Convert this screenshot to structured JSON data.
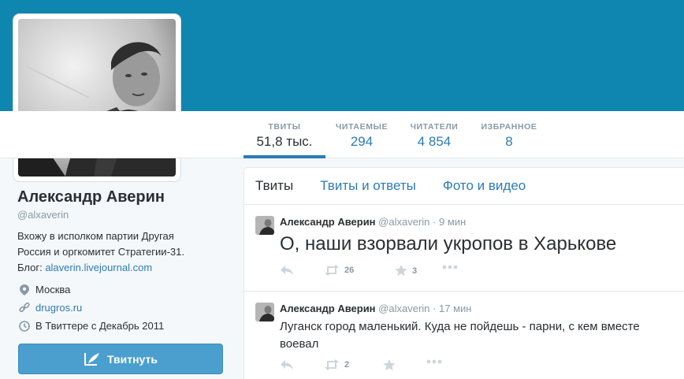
{
  "profile": {
    "name": "Александр Аверин",
    "handle": "@alxaverin",
    "bio_line1": "Вхожу в исполком партии Другая",
    "bio_line2": "Россия и оргкомитет Стратегии-31.",
    "bio_line3_prefix": "Блог: ",
    "bio_link": "alaverin.livejournal.com",
    "location": "Москва",
    "website": "drugros.ru",
    "joined": "В Твиттере с Декабрь 2011",
    "tweet_button": "Твитнуть"
  },
  "stats": [
    {
      "label": "ТВИТЫ",
      "value": "51,8 тыс."
    },
    {
      "label": "ЧИТАЕМЫЕ",
      "value": "294"
    },
    {
      "label": "ЧИТАТЕЛИ",
      "value": "4 854"
    },
    {
      "label": "ИЗБРАННОЕ",
      "value": "8"
    }
  ],
  "timeline": {
    "tabs": [
      "Твиты",
      "Твиты и ответы",
      "Фото и видео"
    ],
    "tweets": [
      {
        "name": "Александр Аверин",
        "handle": "@alxaverin",
        "sep": "·",
        "time": "9 мин",
        "text": "О, наши взорвали укропов в Харькове",
        "retweets": "26",
        "favorites": "3"
      },
      {
        "name": "Александр Аверин",
        "handle": "@alxaverin",
        "sep": "·",
        "time": "17 мин",
        "text": "Луганск город маленький. Куда не пойдешь - парни,  с кем вместе воевал",
        "retweets": "2",
        "favorites": ""
      }
    ]
  },
  "colors": {
    "banner": "#0e86b0",
    "link": "#2b7bb9",
    "button": "#4a9fcf",
    "muted": "#8899a6"
  }
}
